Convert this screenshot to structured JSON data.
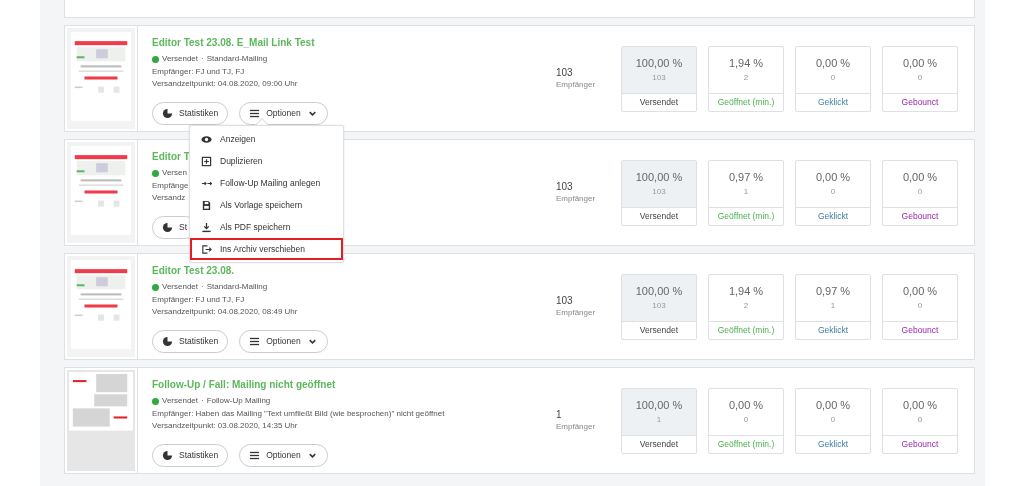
{
  "mailings": [
    {
      "title": "Editor Test 23.08. E_Mail Link Test",
      "status": "Versendet",
      "separator": "·",
      "type": "Standard-Mailing",
      "recipients": "Empfänger: FJ und TJ, FJ",
      "sent_at": "Versandzeitpunkt: 04.08.2020, 09:00 Uhr",
      "count": "103",
      "count_label": "Empfänger",
      "stats_button": "Statistiken",
      "options_button": "Optionen",
      "stats": [
        {
          "kind": "sent",
          "percent": "100,00 %",
          "count": "103",
          "label": "Versendet"
        },
        {
          "kind": "opened",
          "percent": "1,94 %",
          "count": "2",
          "label": "Geöffnet (min.)"
        },
        {
          "kind": "clicked",
          "percent": "0,00 %",
          "count": "0",
          "label": "Geklickt"
        },
        {
          "kind": "bounced",
          "percent": "0,00 %",
          "count": "0",
          "label": "Gebounct"
        }
      ]
    },
    {
      "title": "Editor T",
      "status": "Versen",
      "recipients": "Empfänge",
      "sent_at": "Versandz",
      "count": "103",
      "count_label": "Empfänger",
      "stats_button": "St",
      "stats": [
        {
          "kind": "sent",
          "percent": "100,00 %",
          "count": "103",
          "label": "Versendet"
        },
        {
          "kind": "opened",
          "percent": "0,97 %",
          "count": "1",
          "label": "Geöffnet (min.)"
        },
        {
          "kind": "clicked",
          "percent": "0,00 %",
          "count": "0",
          "label": "Geklickt"
        },
        {
          "kind": "bounced",
          "percent": "0,00 %",
          "count": "0",
          "label": "Gebounct"
        }
      ]
    },
    {
      "title": "Editor Test 23.08.",
      "status": "Versendet",
      "separator": "·",
      "type": "Standard-Mailing",
      "recipients": "Empfänger: FJ und TJ, FJ",
      "sent_at": "Versandzeitpunkt: 04.08.2020, 08:49 Uhr",
      "count": "103",
      "count_label": "Empfänger",
      "stats_button": "Statistiken",
      "options_button": "Optionen",
      "stats": [
        {
          "kind": "sent",
          "percent": "100,00 %",
          "count": "103",
          "label": "Versendet"
        },
        {
          "kind": "opened",
          "percent": "1,94 %",
          "count": "2",
          "label": "Geöffnet (min.)"
        },
        {
          "kind": "clicked",
          "percent": "0,97 %",
          "count": "1",
          "label": "Geklickt"
        },
        {
          "kind": "bounced",
          "percent": "0,00 %",
          "count": "0",
          "label": "Gebounct"
        }
      ]
    },
    {
      "title": "Follow-Up / Fall: Mailing nicht geöffnet",
      "status": "Versendet",
      "separator": "·",
      "type": "Follow-Up Mailing",
      "recipients": "Empfänger: Haben das Mailing \"Text umfließt Bild (wie besprochen)\" nicht geöffnet",
      "sent_at": "Versandzeitpunkt: 03.08.2020, 14:35 Uhr",
      "count": "1",
      "count_label": "Empfänger",
      "stats_button": "Statistiken",
      "options_button": "Optionen",
      "stats": [
        {
          "kind": "sent",
          "percent": "100,00 %",
          "count": "1",
          "label": "Versendet"
        },
        {
          "kind": "opened",
          "percent": "0,00 %",
          "count": "0",
          "label": "Geöffnet (min.)"
        },
        {
          "kind": "clicked",
          "percent": "0,00 %",
          "count": "0",
          "label": "Geklickt"
        },
        {
          "kind": "bounced",
          "percent": "0,00 %",
          "count": "0",
          "label": "Gebounct"
        }
      ]
    }
  ],
  "options_menu": {
    "items": [
      {
        "kind": "view",
        "label": "Anzeigen",
        "highlighted": false
      },
      {
        "kind": "duplicate",
        "label": "Duplizieren",
        "highlighted": false
      },
      {
        "kind": "followup",
        "label": "Follow-Up Mailing anlegen",
        "highlighted": false
      },
      {
        "kind": "template",
        "label": "Als Vorlage speichern",
        "highlighted": false
      },
      {
        "kind": "pdf",
        "label": "Als PDF speichern",
        "highlighted": false
      },
      {
        "kind": "archive",
        "label": "Ins Archiv verschieben",
        "highlighted": true
      }
    ]
  }
}
